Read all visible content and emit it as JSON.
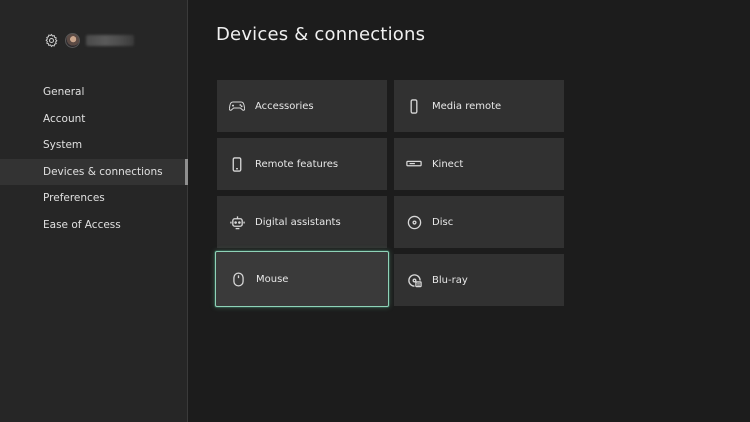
{
  "page": {
    "title": "Devices & connections"
  },
  "sidebar": {
    "icons": {
      "settings": "gear-icon",
      "profile": "avatar"
    },
    "items": [
      {
        "label": "General",
        "active": false
      },
      {
        "label": "Account",
        "active": false
      },
      {
        "label": "System",
        "active": false
      },
      {
        "label": "Devices & connections",
        "active": true
      },
      {
        "label": "Preferences",
        "active": false
      },
      {
        "label": "Ease of Access",
        "active": false
      }
    ]
  },
  "tiles": [
    {
      "label": "Accessories",
      "icon": "gamepad-icon"
    },
    {
      "label": "Media remote",
      "icon": "remote-icon"
    },
    {
      "label": "Remote features",
      "icon": "phone-icon"
    },
    {
      "label": "Kinect",
      "icon": "kinect-icon"
    },
    {
      "label": "Digital assistants",
      "icon": "assistant-icon"
    },
    {
      "label": "Disc",
      "icon": "disc-icon"
    },
    {
      "label": "Mouse",
      "icon": "mouse-icon",
      "focused": true
    },
    {
      "label": "Blu-ray",
      "icon": "bluray-icon"
    }
  ],
  "colors": {
    "background": "#1c1c1c",
    "sidebar": "#262626",
    "tile": "#313131",
    "focus": "#8fd3b8"
  }
}
